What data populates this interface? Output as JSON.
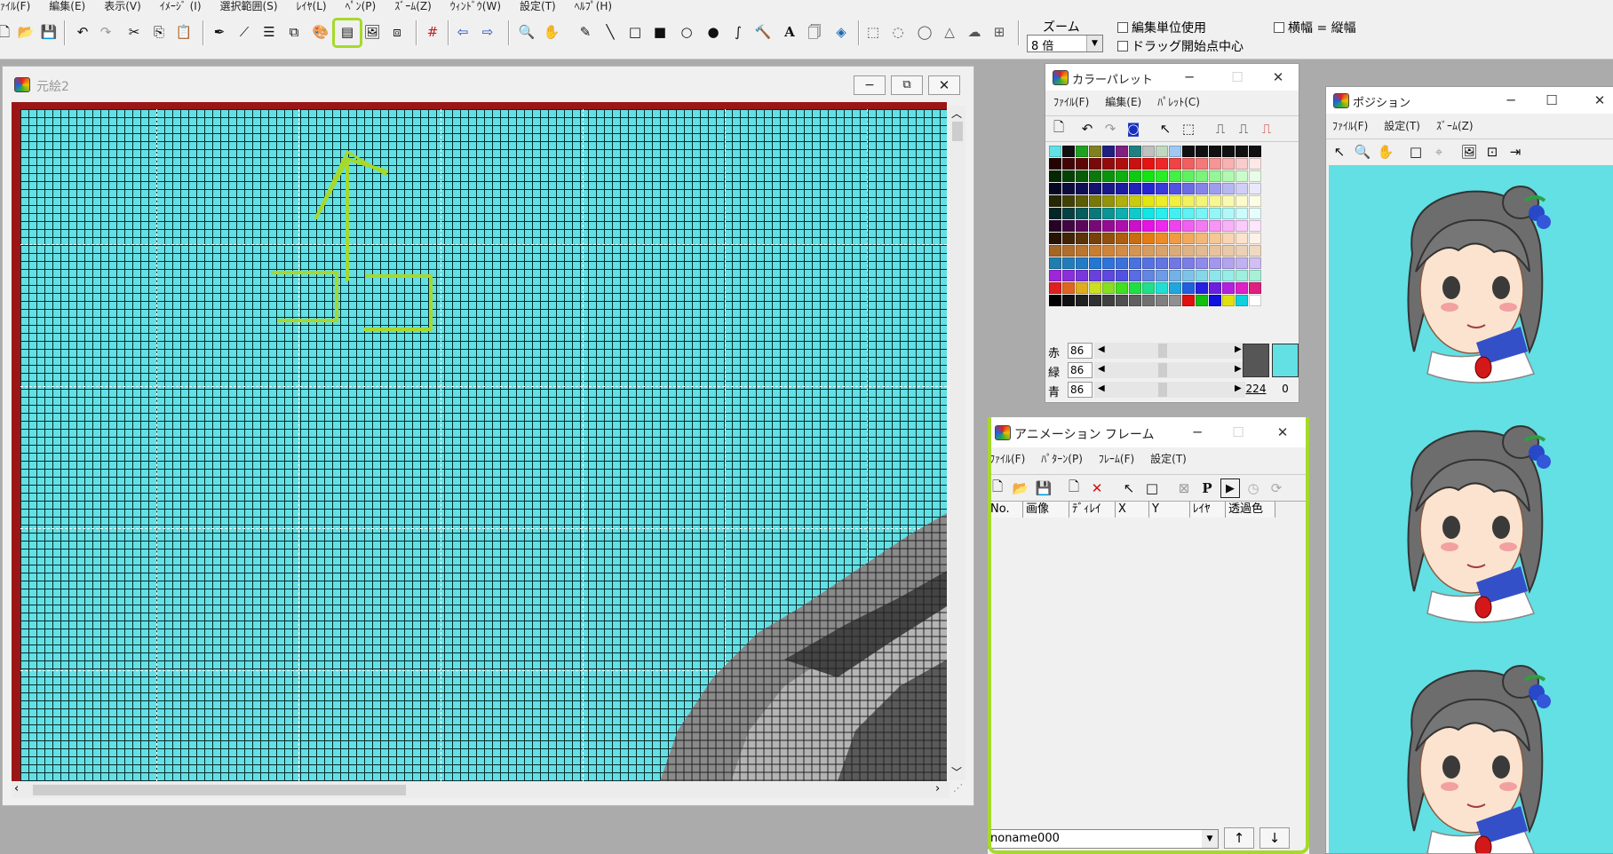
{
  "menu": [
    "ﾌｧｲﾙ(F)",
    "編集(E)",
    "表示(V)",
    "ｲﾒｰｼﾞ (I)",
    "選択範囲(S)",
    "ﾚｲﾔ(L)",
    "ﾍﾟﾝ(P)",
    "ｽﾞｰﾑ(Z)",
    "ｳｨﾝﾄﾞｳ(W)",
    "設定(T)",
    "ﾍﾙﾌﾟ(H)"
  ],
  "toolbar": {
    "zoom_label": "ズーム",
    "zoom_value": "8 倍",
    "chk_unit": "編集単位使用",
    "chk_drag": "ドラッグ開始点中心",
    "chk_aspect": "横幅 = 縦幅"
  },
  "canvas_window": {
    "title": "元絵2"
  },
  "palette_window": {
    "title": "カラーパレット",
    "menus": [
      "ﾌｧｲﾙ(F)",
      "編集(E)",
      "ﾊﾟﾚｯﾄ(C)"
    ],
    "rgb_labels": [
      "赤",
      "緑",
      "青"
    ],
    "rgb_values": [
      "86",
      "86",
      "86"
    ],
    "index_fg": "224",
    "index_bg": "0"
  },
  "anim_window": {
    "title": "アニメーション フレーム",
    "menus": [
      "ﾌｧｲﾙ(F)",
      "ﾊﾟﾀｰﾝ(P)",
      "ﾌﾚｰﾑ(F)",
      "設定(T)"
    ],
    "columns": [
      "No.",
      "画像",
      "ﾃﾞｨﾚｲ",
      "X",
      "Y",
      "ﾚｲﾔ",
      "透過色"
    ],
    "pattern_name": "noname000"
  },
  "position_window": {
    "title": "ポジション",
    "menus": [
      "ﾌｧｲﾙ(F)",
      "設定(T)",
      "ｽﾞｰﾑ(Z)"
    ]
  },
  "colors": {
    "accent_highlight": "#a6d92b",
    "canvas_bg": "#62e0e4",
    "frame_border": "#9b1616"
  }
}
